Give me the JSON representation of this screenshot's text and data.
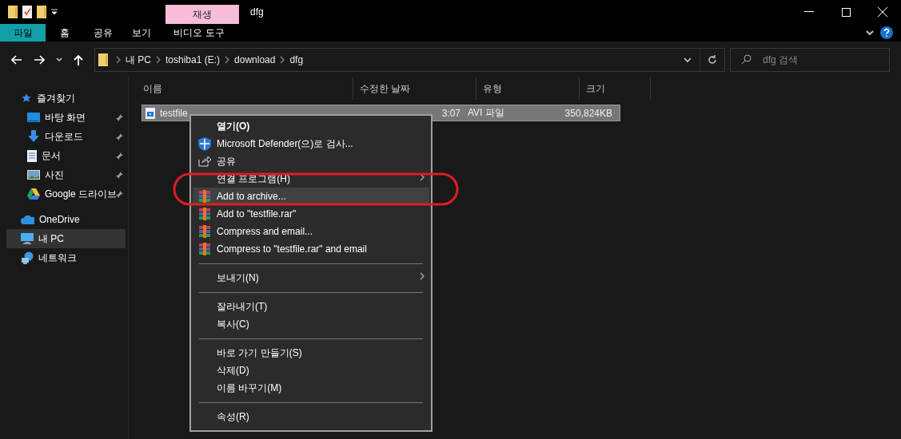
{
  "window": {
    "title": "dfg",
    "context_group": "재생"
  },
  "ribbon_tabs": [
    {
      "label": "파일",
      "kind": "file",
      "selected": false
    },
    {
      "label": "홈",
      "kind": "plain",
      "selected": false
    },
    {
      "label": "공유",
      "kind": "plain",
      "selected": false
    },
    {
      "label": "보기",
      "kind": "plain",
      "selected": false
    },
    {
      "label": "비디오 도구",
      "kind": "contextual",
      "selected": false
    }
  ],
  "address": {
    "path": [
      "내 PC",
      "toshiba1 (E:)",
      "download",
      "dfg"
    ]
  },
  "search": {
    "placeholder": "dfg 검색"
  },
  "sidebar": {
    "items": [
      {
        "label": "즐겨찾기",
        "selected": false,
        "children": [
          {
            "label": "바탕 화면",
            "pinned": true,
            "selected": false
          },
          {
            "label": "다운로드",
            "pinned": true,
            "selected": false
          },
          {
            "label": "문서",
            "pinned": true,
            "selected": false
          },
          {
            "label": "사진",
            "pinned": true,
            "selected": false
          },
          {
            "label": "Google 드라이브",
            "pinned": true,
            "selected": false
          }
        ]
      },
      {
        "label": "OneDrive",
        "selected": false
      },
      {
        "label": "내 PC",
        "selected": true
      },
      {
        "label": "네트워크",
        "selected": false
      }
    ]
  },
  "table": {
    "columns": [
      "이름",
      "수정한 날짜",
      "유형",
      "크기"
    ],
    "rows": [
      {
        "name": "testfile",
        "modified": "3:07",
        "type": "AVI 파일",
        "size": "350,824KB",
        "selected": true
      }
    ]
  },
  "context_menu": {
    "items": [
      {
        "kind": "item",
        "label": "열기(O)",
        "default": true,
        "selected": false
      },
      {
        "kind": "item",
        "label": "Microsoft Defender(으)로 검사...",
        "default": false,
        "selected": false
      },
      {
        "kind": "item",
        "label": "공유",
        "default": false,
        "selected": false
      },
      {
        "kind": "submenu",
        "label": "연결 프로그램(H)",
        "default": false,
        "selected": false
      },
      {
        "kind": "item",
        "label": "Add to archive...",
        "default": false,
        "selected": true
      },
      {
        "kind": "item",
        "label": "Add to \"testfile.rar\"",
        "default": false,
        "selected": false
      },
      {
        "kind": "item",
        "label": "Compress and email...",
        "default": false,
        "selected": false
      },
      {
        "kind": "item",
        "label": "Compress to \"testfile.rar\" and email",
        "default": false,
        "selected": false
      },
      {
        "kind": "separator"
      },
      {
        "kind": "submenu",
        "label": "보내기(N)",
        "default": false,
        "selected": false
      },
      {
        "kind": "separator"
      },
      {
        "kind": "item",
        "label": "잘라내기(T)",
        "default": false,
        "selected": false
      },
      {
        "kind": "item",
        "label": "복사(C)",
        "default": false,
        "selected": false
      },
      {
        "kind": "separator"
      },
      {
        "kind": "item",
        "label": "바로 가기 만들기(S)",
        "default": false,
        "selected": false
      },
      {
        "kind": "item",
        "label": "삭제(D)",
        "default": false,
        "selected": false
      },
      {
        "kind": "item",
        "label": "이름 바꾸기(M)",
        "default": false,
        "selected": false
      },
      {
        "kind": "separator"
      },
      {
        "kind": "item",
        "label": "속성(R)",
        "default": false,
        "selected": false
      }
    ]
  }
}
